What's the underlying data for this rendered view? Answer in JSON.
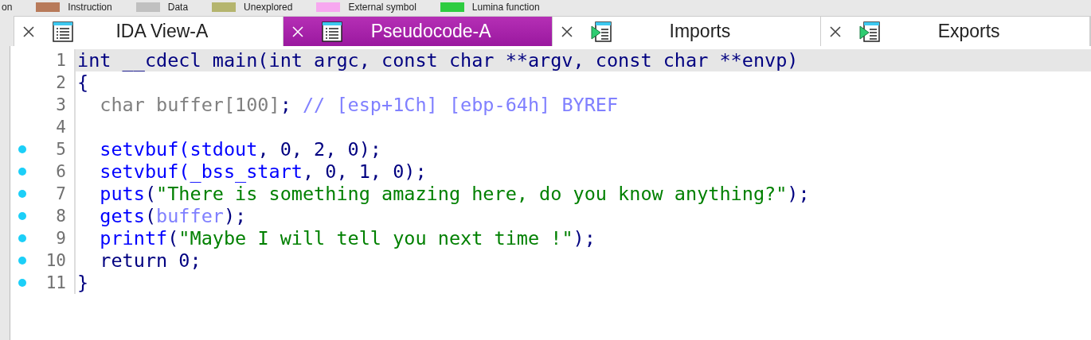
{
  "legend": [
    {
      "label": "on"
    },
    {
      "label": "Instruction",
      "color": "#b87a5a"
    },
    {
      "label": "Data",
      "color": "#c0c0c0"
    },
    {
      "label": "Unexplored",
      "color": "#b5b56e"
    },
    {
      "label": "External symbol",
      "color": "#f7a8f0"
    },
    {
      "label": "Lumina function",
      "color": "#2ecc40"
    }
  ],
  "tabs": [
    {
      "label": "IDA View-A",
      "kind": "listing",
      "selected": false
    },
    {
      "label": "Pseudocode-A",
      "kind": "listing",
      "selected": true
    },
    {
      "label": "Imports",
      "kind": "arrow",
      "selected": false
    },
    {
      "label": "Exports",
      "kind": "arrow",
      "selected": false
    }
  ],
  "code": [
    {
      "number": "1",
      "dot": false,
      "selected": true,
      "tokens": [
        {
          "kind": "keyword",
          "text": "int __cdecl main(int argc, const char **argv, const char **envp)"
        }
      ]
    },
    {
      "number": "2",
      "dot": false,
      "selected": false,
      "tokens": [
        {
          "kind": "keyword",
          "text": "{"
        }
      ]
    },
    {
      "number": "3",
      "dot": false,
      "selected": false,
      "tokens": [
        {
          "kind": "local",
          "text": "  char buffer[100]"
        },
        {
          "kind": "keyword",
          "text": "; "
        },
        {
          "kind": "comment",
          "text": "// [esp+1Ch] [ebp-64h] BYREF"
        }
      ]
    },
    {
      "number": "4",
      "dot": false,
      "selected": false
    },
    {
      "number": "5",
      "dot": true,
      "selected": false,
      "tokens": [
        {
          "kind": "func",
          "text": "  setvbuf(stdout"
        },
        {
          "kind": "keyword",
          "text": ", 0, 2, 0);"
        }
      ]
    },
    {
      "number": "6",
      "dot": true,
      "selected": false,
      "tokens": [
        {
          "kind": "func",
          "text": "  setvbuf("
        },
        {
          "kind": "func",
          "text": "_bss_start"
        },
        {
          "kind": "keyword",
          "text": ", 0, 1, 0);"
        }
      ]
    },
    {
      "number": "7",
      "dot": true,
      "selected": false,
      "tokens": [
        {
          "kind": "func",
          "text": "  puts"
        },
        {
          "kind": "keyword",
          "text": "("
        },
        {
          "kind": "string",
          "text": "\"There is something amazing here, do you know anything?\""
        },
        {
          "kind": "keyword",
          "text": ");"
        }
      ]
    },
    {
      "number": "8",
      "dot": true,
      "selected": false,
      "tokens": [
        {
          "kind": "func",
          "text": "  gets"
        },
        {
          "kind": "keyword",
          "text": "("
        },
        {
          "kind": "var",
          "text": "buffer"
        },
        {
          "kind": "keyword",
          "text": ");"
        }
      ]
    },
    {
      "number": "9",
      "dot": true,
      "selected": false,
      "tokens": [
        {
          "kind": "func",
          "text": "  printf"
        },
        {
          "kind": "keyword",
          "text": "("
        },
        {
          "kind": "string",
          "text": "\"Maybe I will tell you next time !\""
        },
        {
          "kind": "keyword",
          "text": ");"
        }
      ]
    },
    {
      "number": "10",
      "dot": true,
      "selected": false,
      "tokens": [
        {
          "kind": "keyword",
          "text": "  return 0;"
        }
      ]
    },
    {
      "number": "11",
      "dot": true,
      "selected": false,
      "tokens": [
        {
          "kind": "keyword",
          "text": "}"
        }
      ]
    }
  ]
}
